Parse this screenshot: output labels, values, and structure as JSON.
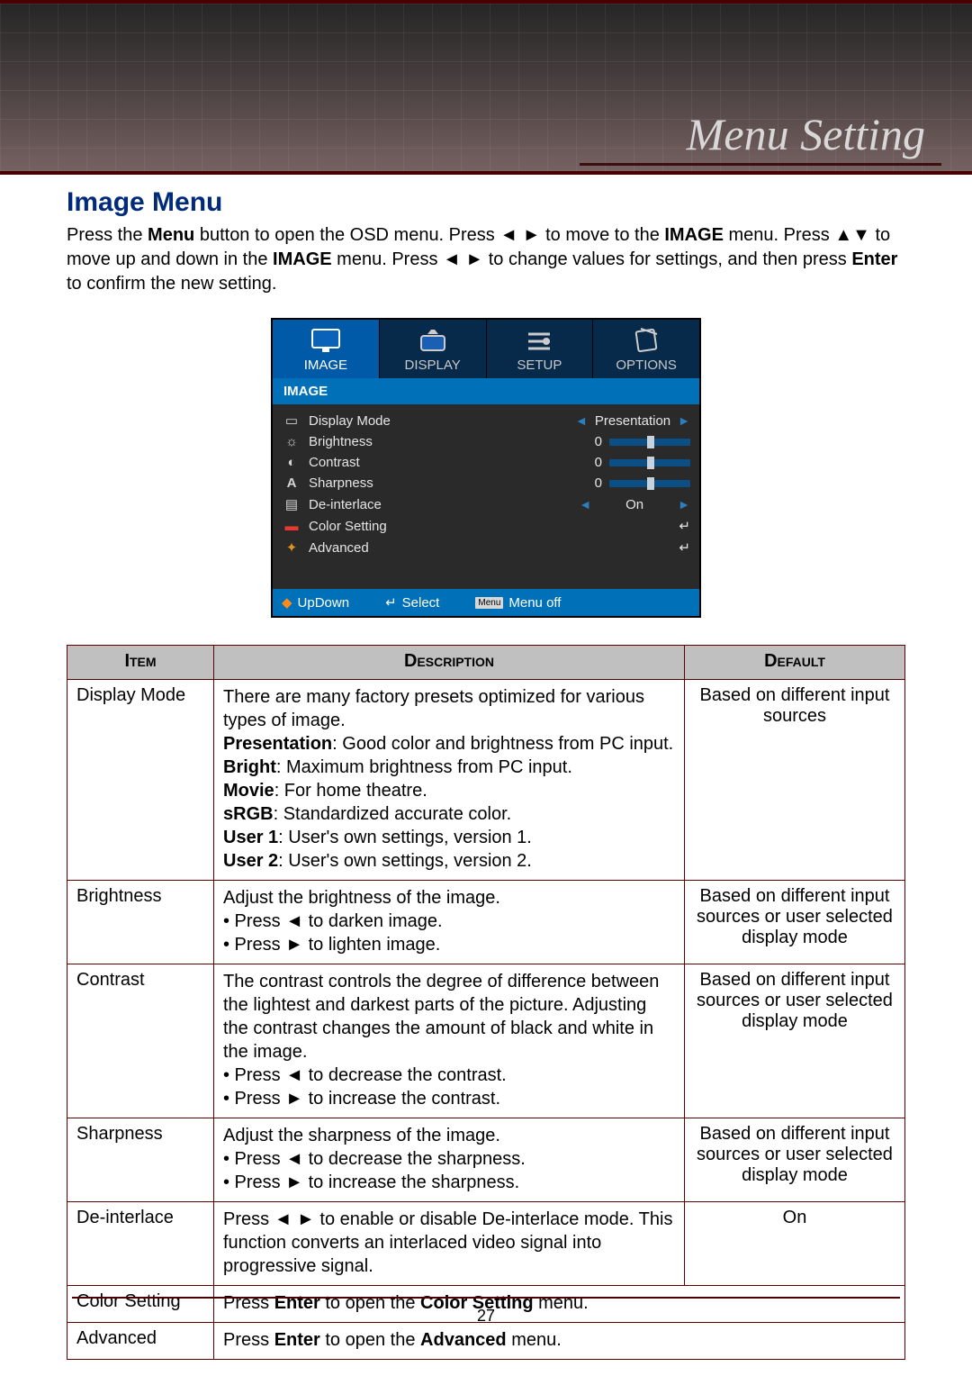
{
  "banner": {
    "title": "Menu Setting"
  },
  "heading": "Image Menu",
  "intro": {
    "line1_a": "Press the ",
    "menu": "Menu",
    "line1_b": " button to open the OSD menu. Press ",
    "lr1": "◄ ►",
    "line1_c": " to move to the ",
    "image1": "IMAGE",
    "line1_d": " menu. Press ",
    "ud": "▲▼",
    "line1_e": " to move up and down in the ",
    "image2": "IMAGE",
    "line1_f": " menu. Press ",
    "lr2": "◄ ►",
    "line1_g": " to change values for settings, and then press ",
    "enter": "Enter",
    "line1_h": " to confirm the new setting."
  },
  "osd": {
    "tabs": [
      {
        "label": "IMAGE",
        "active": true
      },
      {
        "label": "DISPLAY",
        "active": false
      },
      {
        "label": "SETUP",
        "active": false
      },
      {
        "label": "OPTIONS",
        "active": false
      }
    ],
    "section": "IMAGE",
    "rows": {
      "display_mode": {
        "label": "Display Mode",
        "value": "Presentation"
      },
      "brightness": {
        "label": "Brightness",
        "value": "0"
      },
      "contrast": {
        "label": "Contrast",
        "value": "0"
      },
      "sharpness": {
        "label": "Sharpness",
        "value": "0"
      },
      "deinterlace": {
        "label": "De-interlace",
        "value": "On"
      },
      "color": {
        "label": "Color Setting"
      },
      "advanced": {
        "label": "Advanced"
      }
    },
    "footer": {
      "updown": "UpDown",
      "select": "Select",
      "menuoff": "Menu off",
      "menubox": "Menu"
    }
  },
  "table": {
    "headers": {
      "item": "Item",
      "desc": "Description",
      "def": "Default"
    },
    "rows": [
      {
        "item": "Display Mode",
        "desc_plain": "There are many factory presets optimized for various types of image.",
        "modes": [
          {
            "name": "Presentation",
            "text": ": Good color and brightness from PC input."
          },
          {
            "name": "Bright",
            "text": ": Maximum brightness from PC input."
          },
          {
            "name": "Movie",
            "text": ": For home theatre."
          },
          {
            "name": "sRGB",
            "text": ": Standardized accurate color."
          },
          {
            "name": "User 1",
            "text": ": User's own settings, version 1."
          },
          {
            "name": "User 2",
            "text": ": User's own settings, version 2."
          }
        ],
        "def": "Based on different input sources"
      },
      {
        "item": "Brightness",
        "desc_lines": [
          "Adjust the brightness of the image.",
          "• Press ◄ to darken image.",
          "• Press ► to lighten image."
        ],
        "def": "Based on different input sources or user selected display mode"
      },
      {
        "item": "Contrast",
        "desc_lines": [
          "The contrast controls the degree of difference between the lightest and darkest parts of the picture. Adjusting the contrast changes the amount of black and white in the image.",
          "• Press ◄ to decrease the contrast.",
          "• Press ► to increase the contrast."
        ],
        "def": "Based on different input sources or user selected display mode"
      },
      {
        "item": "Sharpness",
        "desc_lines": [
          "Adjust the sharpness of the image.",
          "• Press ◄ to decrease the sharpness.",
          "• Press ► to increase the sharpness."
        ],
        "def": "Based on different input sources or user selected display mode"
      },
      {
        "item": "De-interlace",
        "desc_plain": "Press ◄ ► to enable or disable De-interlace mode. This function converts an interlaced video signal into progressive signal.",
        "def": "On"
      },
      {
        "item": "Color Setting",
        "desc_rich": {
          "a": "Press ",
          "b": "Enter",
          "c": " to open the ",
          "d": "Color Setting",
          "e": " menu."
        }
      },
      {
        "item": "Advanced",
        "desc_rich": {
          "a": "Press ",
          "b": "Enter",
          "c": " to open the ",
          "d": "Advanced",
          "e": " menu."
        }
      }
    ]
  },
  "page_number": "27"
}
